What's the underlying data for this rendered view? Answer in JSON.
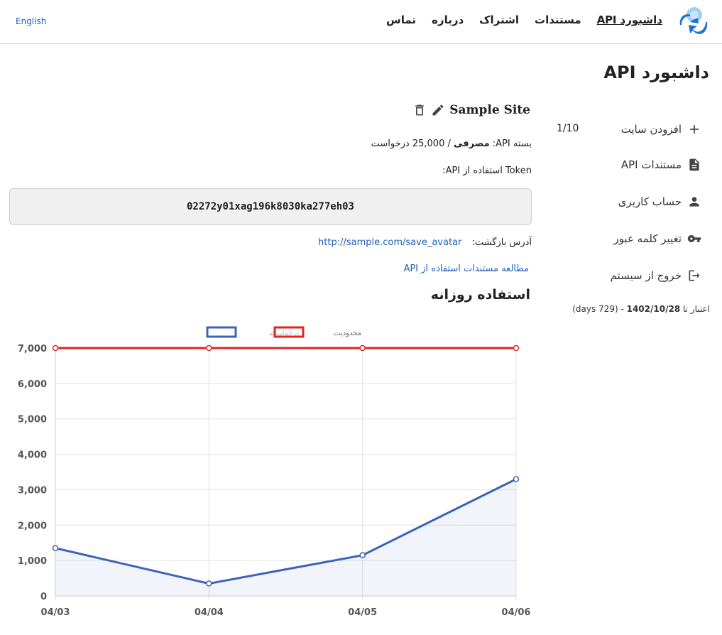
{
  "header": {
    "nav": [
      {
        "label": "داشبورد API",
        "active": true
      },
      {
        "label": "مستندات",
        "active": false
      },
      {
        "label": "اشتراک",
        "active": false
      },
      {
        "label": "درباره",
        "active": false
      },
      {
        "label": "تماس",
        "active": false
      }
    ],
    "language": "English",
    "logo_icon": "logo-icon"
  },
  "page_title": "داشبورد API",
  "sidebar": {
    "items": [
      {
        "label": "افزودن سایت",
        "icon": "plus-icon"
      },
      {
        "label": "مستندات API",
        "icon": "document-icon"
      },
      {
        "label": "حساب کاربری",
        "icon": "user-icon"
      },
      {
        "label": "تغییر کلمه عبور",
        "icon": "key-icon"
      },
      {
        "label": "خروج از سیستم",
        "icon": "logout-icon"
      }
    ],
    "site_count": "1/10",
    "validity": {
      "prefix": "اعتبار تا",
      "date": "1402/10/28",
      "suffix": "- (729 days)"
    }
  },
  "site": {
    "name": "Sample Site",
    "package_label": "بسته API:",
    "package_name": "مصرفی",
    "package_quota": "/ 25,000 درخواست",
    "token_label": "Token استفاده از API:",
    "token": "02272y01xag196k8030ka277eh03",
    "callback_label": "آدرس بازگشت:",
    "callback_url": "http://sample.com/save_avatar",
    "docs_link": "مطالعه مستندات استفاده از API"
  },
  "usage_title": "استفاده روزانه",
  "chart_data": {
    "type": "line",
    "categories": [
      "04/03",
      "04/04",
      "04/05",
      "04/06"
    ],
    "series": [
      {
        "name": "محدودیت",
        "values": [
          7000,
          7000,
          7000,
          7000
        ],
        "color": "#e02424"
      },
      {
        "name": "درخواست",
        "values": [
          1350,
          350,
          1150,
          3300
        ],
        "color": "#3d63b8"
      }
    ],
    "yticks": [
      "0",
      "1,000",
      "2,000",
      "3,000",
      "4,000",
      "5,000",
      "6,000",
      "7,000"
    ],
    "ylim": [
      0,
      7000
    ],
    "grid": true,
    "legend": "top"
  }
}
